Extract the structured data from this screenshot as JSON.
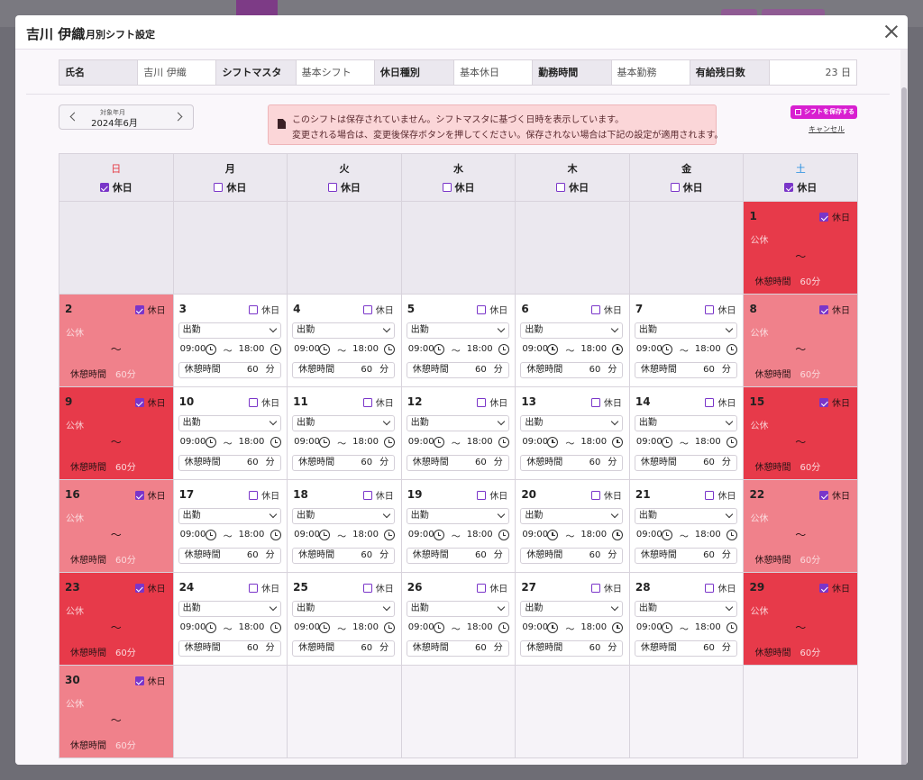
{
  "modal": {
    "title": "吉川 伊織",
    "subtitle": "月別シフト設定"
  },
  "info": [
    {
      "label": "氏名",
      "value": "吉川 伊織"
    },
    {
      "label": "シフトマスタ",
      "value": "基本シフト"
    },
    {
      "label": "休日種別",
      "value": "基本休日"
    },
    {
      "label": "勤務時間",
      "value": "基本勤務"
    },
    {
      "label": "有給残日数",
      "value": "23 日"
    }
  ],
  "month_nav": {
    "label": "対象年月",
    "value": "2024年6月"
  },
  "alert": {
    "line1": "このシフトは保存されていません。シフトマスタに基づく日時を表示しています。",
    "line2": "変更される場合は、変更後保存ボタンを押してください。保存されない場合は下記の設定が適用されます。"
  },
  "actions": {
    "save": "シフトを保存する",
    "cancel": "キャンセル"
  },
  "weekdays": [
    {
      "name": "日",
      "holiday": true,
      "label": "休日"
    },
    {
      "name": "月",
      "holiday": false,
      "label": "休日"
    },
    {
      "name": "火",
      "holiday": false,
      "label": "休日"
    },
    {
      "name": "水",
      "holiday": false,
      "label": "休日"
    },
    {
      "name": "木",
      "holiday": false,
      "label": "休日"
    },
    {
      "name": "金",
      "holiday": false,
      "label": "休日"
    },
    {
      "name": "土",
      "holiday": true,
      "label": "休日"
    }
  ],
  "day_labels": {
    "holiday_check": "休日",
    "holiday_type": "公休",
    "tilde": "～",
    "rest": "休憩時間",
    "rest_value": "60分",
    "work": "出勤",
    "start": "09:00",
    "end": "18:00",
    "rest_minutes": "60",
    "rest_unit": "分"
  },
  "colors": {
    "accent": "#7a35c9",
    "save": "#d81fd0",
    "holiday_red": "#e73a4a",
    "holiday_pink": "#f0818b"
  },
  "weeks": [
    [
      null,
      null,
      null,
      null,
      null,
      null,
      {
        "day": 1,
        "holiday": true,
        "tone": "red"
      }
    ],
    [
      {
        "day": 2,
        "holiday": true,
        "tone": "pink"
      },
      {
        "day": 3
      },
      {
        "day": 4
      },
      {
        "day": 5
      },
      {
        "day": 6
      },
      {
        "day": 7
      },
      {
        "day": 8,
        "holiday": true,
        "tone": "pink"
      }
    ],
    [
      {
        "day": 9,
        "holiday": true,
        "tone": "red"
      },
      {
        "day": 10
      },
      {
        "day": 11
      },
      {
        "day": 12
      },
      {
        "day": 13
      },
      {
        "day": 14
      },
      {
        "day": 15,
        "holiday": true,
        "tone": "red"
      }
    ],
    [
      {
        "day": 16,
        "holiday": true,
        "tone": "pink"
      },
      {
        "day": 17
      },
      {
        "day": 18
      },
      {
        "day": 19
      },
      {
        "day": 20
      },
      {
        "day": 21
      },
      {
        "day": 22,
        "holiday": true,
        "tone": "pink"
      }
    ],
    [
      {
        "day": 23,
        "holiday": true,
        "tone": "red"
      },
      {
        "day": 24
      },
      {
        "day": 25
      },
      {
        "day": 26
      },
      {
        "day": 27
      },
      {
        "day": 28
      },
      {
        "day": 29,
        "holiday": true,
        "tone": "red"
      }
    ],
    [
      {
        "day": 30,
        "holiday": true,
        "tone": "pink"
      },
      null,
      null,
      null,
      null,
      null,
      null
    ]
  ]
}
